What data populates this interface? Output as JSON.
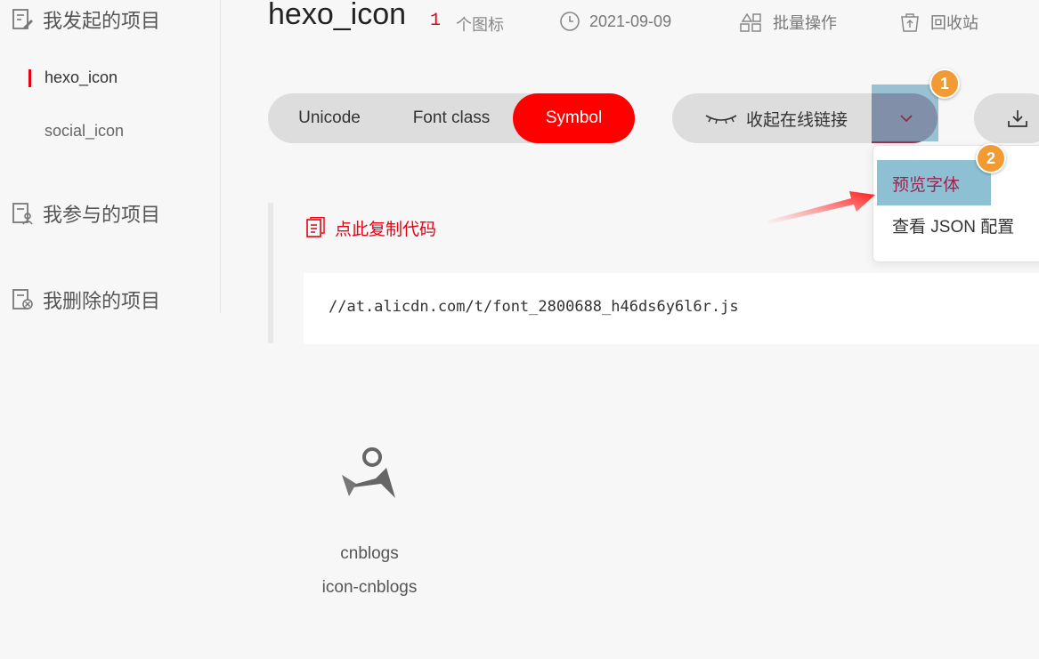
{
  "sidebar": {
    "my_projects": "我发起的项目",
    "projects": [
      "hexo_icon",
      "social_icon"
    ],
    "joined_projects": "我参与的项目",
    "deleted_projects": "我删除的项目"
  },
  "header": {
    "project_name": "hexo_icon",
    "icon_count": "1",
    "icon_unit": "个图标",
    "date": "2021-09-09",
    "batch_label": "批量操作",
    "recycle_label": "回收站"
  },
  "toolbar": {
    "tabs": [
      "Unicode",
      "Font class",
      "Symbol"
    ],
    "selected_tab": "Symbol",
    "collapse_label": "收起在线链接"
  },
  "dropdown": {
    "items": [
      "预览字体",
      "查看 JSON 配置"
    ]
  },
  "badges": [
    "1",
    "2"
  ],
  "code_panel": {
    "copy_label": "点此复制代码",
    "url": "//at.alicdn.com/t/font_2800688_h46ds6y6l6r.js"
  },
  "icon_card": {
    "name": "cnblogs",
    "code": "icon-cnblogs"
  },
  "colors": {
    "accent": "#e60012",
    "active_tab": "#ff0000",
    "chevron_bg": "#a0324a",
    "highlight": "#8ec0d3",
    "badge": "#f29a33"
  }
}
